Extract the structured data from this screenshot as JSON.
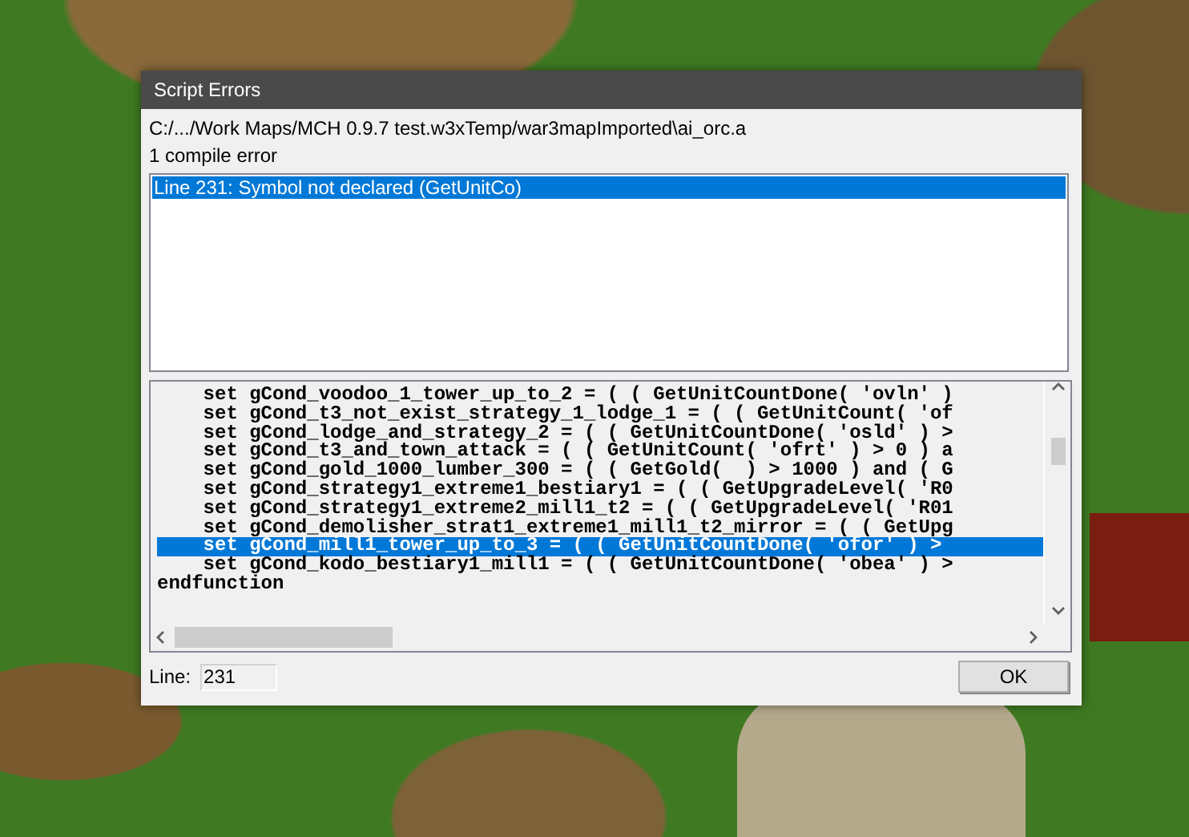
{
  "window": {
    "title": "Script Errors"
  },
  "file_path": "C:/.../Work Maps/MCH 0.9.7 test.w3xTemp/war3mapImported\\ai_orc.a",
  "error_count": "1 compile error",
  "errors": [
    {
      "text": "Line 231: Symbol not declared (GetUnitCo)",
      "selected": true
    }
  ],
  "code_lines": [
    {
      "text": "    set gCond_voodoo_1_tower_up_to_2 = ( ( GetUnitCountDone( 'ovln' )",
      "selected": false
    },
    {
      "text": "    set gCond_t3_not_exist_strategy_1_lodge_1 = ( ( GetUnitCount( 'of",
      "selected": false
    },
    {
      "text": "    set gCond_lodge_and_strategy_2 = ( ( GetUnitCountDone( 'osld' ) >",
      "selected": false
    },
    {
      "text": "    set gCond_t3_and_town_attack = ( ( GetUnitCount( 'ofrt' ) > 0 ) a",
      "selected": false
    },
    {
      "text": "    set gCond_gold_1000_lumber_300 = ( ( GetGold(  ) > 1000 ) and ( G",
      "selected": false
    },
    {
      "text": "    set gCond_strategy1_extreme1_bestiary1 = ( ( GetUpgradeLevel( 'R0",
      "selected": false
    },
    {
      "text": "    set gCond_strategy1_extreme2_mill1_t2 = ( ( GetUpgradeLevel( 'R01",
      "selected": false
    },
    {
      "text": "    set gCond_demolisher_strat1_extreme1_mill1_t2_mirror = ( ( GetUpg",
      "selected": false
    },
    {
      "text": "    set gCond_mill1_tower_up_to_3 = ( ( GetUnitCountDone( 'ofor' ) >",
      "selected": true
    },
    {
      "text": "    set gCond_kodo_bestiary1_mill1 = ( ( GetUnitCountDone( 'obea' ) >",
      "selected": false
    },
    {
      "text": "endfunction",
      "selected": false
    }
  ],
  "line_field": {
    "label": "Line:",
    "value": "231"
  },
  "buttons": [
    "OK"
  ]
}
